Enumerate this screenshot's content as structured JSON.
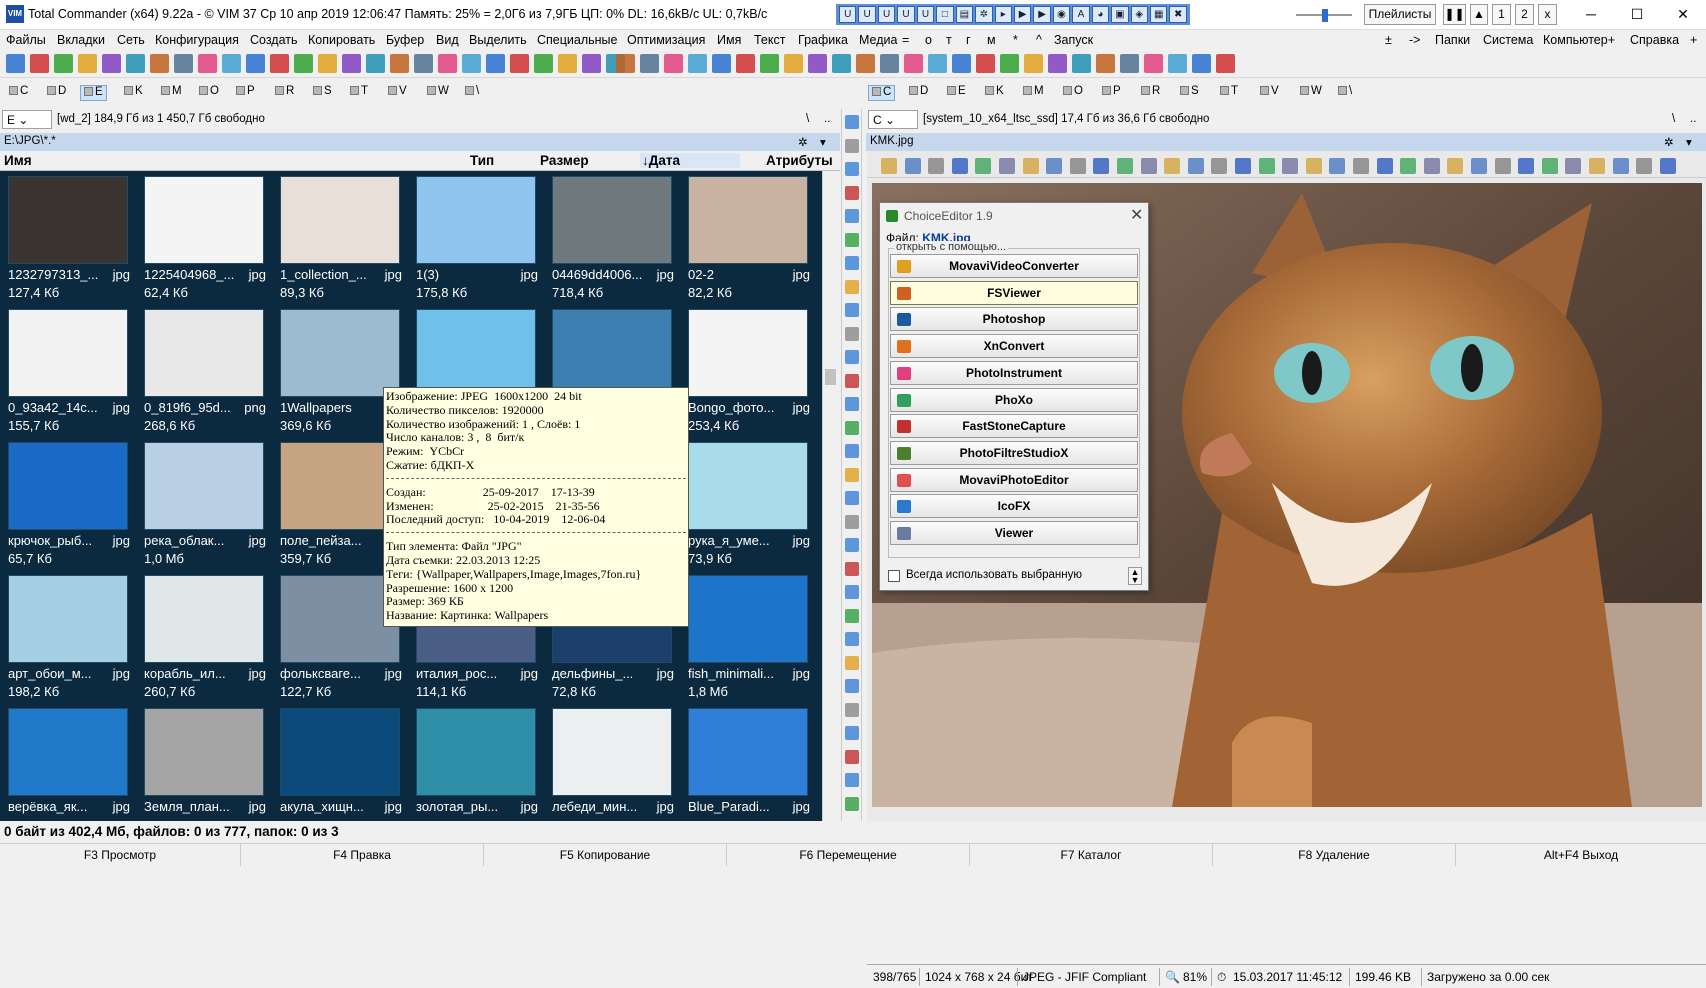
{
  "window": {
    "title": "Total Commander (x64) 9.22a - © VIM 37   Ср 10 апр 2019   12:06:47   Память: 25% = 2,0Г6 из 7,9ГБ   ЦП: 0%   DL: 16,6kB/c   UL: 0,7kB/c",
    "app_icon": "VIM",
    "playlists": "Плейлисты",
    "media_buttons": [
      "❚❚",
      "▲",
      "1",
      "2",
      "x"
    ]
  },
  "menu": [
    "Файлы",
    "Вкладки",
    "Сеть",
    "Конфигурация",
    "Создать",
    "Копировать",
    "Буфер",
    "Вид",
    "Выделить",
    "Специальные",
    "Оптимизация",
    "Имя",
    "Текст",
    "Графика",
    "Медиа",
    "=",
    "о",
    "т",
    "г",
    "м",
    "*",
    "^",
    "Запуск"
  ],
  "menu_right": [
    "±",
    "->",
    "Папки",
    "Система",
    "Компьютер+",
    "Справка",
    "+"
  ],
  "drives_left": [
    "C",
    "D",
    "E",
    "K",
    "M",
    "O",
    "P",
    "R",
    "S",
    "T",
    "V",
    "W",
    "\\"
  ],
  "drives_right": [
    "C",
    "D",
    "E",
    "K",
    "M",
    "O",
    "P",
    "R",
    "S",
    "T",
    "V",
    "W",
    "\\"
  ],
  "left": {
    "drive": "E",
    "drive_info": "[wd_2]  184,9 Гб из 1 450,7 Гб свободно",
    "path": "E:\\JPG\\*.*",
    "columns": [
      "Имя",
      "Тип",
      "Размер",
      "↓Дата",
      "Атрибуты"
    ],
    "files": [
      {
        "name": "1232797313_...",
        "ext": "jpg",
        "size": "127,4 Кб",
        "color": "#3a3430"
      },
      {
        "name": "1225404968_...",
        "ext": "jpg",
        "size": "62,4 Кб",
        "color": "#f4f4f4"
      },
      {
        "name": "1_collection_...",
        "ext": "jpg",
        "size": "89,3 Кб",
        "color": "#e8e0d8"
      },
      {
        "name": "1(3)",
        "ext": "jpg",
        "size": "175,8 Кб",
        "color": "#8ec4ee"
      },
      {
        "name": "04469dd4006...",
        "ext": "jpg",
        "size": "718,4 Кб",
        "color": "#6e7a7e"
      },
      {
        "name": "02-2",
        "ext": "jpg",
        "size": "82,2 Кб",
        "color": "#c8b4a0"
      },
      {
        "name": "0_93a42_14c...",
        "ext": "jpg",
        "size": "155,7 Кб",
        "color": "#f2f2f2"
      },
      {
        "name": "0_819f6_95d...",
        "ext": "png",
        "size": "268,6 Кб",
        "color": "#e8e8e8"
      },
      {
        "name": "1Wallpapers",
        "ext": "",
        "size": "369,6 Кб",
        "color": "#9cbbd0"
      },
      {
        "name": "",
        "ext": "",
        "size": "",
        "color": "#6fc0ea"
      },
      {
        "name": "",
        "ext": "",
        "size": "",
        "color": "#3d7fb0"
      },
      {
        "name": "Bongo_фото...",
        "ext": "jpg",
        "size": "253,4 Кб",
        "color": "#f4f4f4"
      },
      {
        "name": "крючок_рыб...",
        "ext": "jpg",
        "size": "65,7 Кб",
        "color": "#1a6ac8"
      },
      {
        "name": "река_облак...",
        "ext": "jpg",
        "size": "1,0 Мб",
        "color": "#b9cfe3"
      },
      {
        "name": "поле_пейза...",
        "ext": "jpg",
        "size": "359,7 Кб",
        "color": "#c7a582"
      },
      {
        "name": "",
        "ext": "",
        "size": "",
        "color": "#8fbfe0"
      },
      {
        "name": "",
        "ext": "",
        "size": "",
        "color": "#5f9fd0"
      },
      {
        "name": "рука_я_уме...",
        "ext": "jpg",
        "size": "73,9 Кб",
        "color": "#a8dce8"
      },
      {
        "name": "арт_обои_м...",
        "ext": "jpg",
        "size": "198,2 Кб",
        "color": "#a7cfe4"
      },
      {
        "name": "корабль_ил...",
        "ext": "jpg",
        "size": "260,7 Кб",
        "color": "#dfe7e8"
      },
      {
        "name": "фольксваге...",
        "ext": "jpg",
        "size": "122,7 Кб",
        "color": "#7d8fa2"
      },
      {
        "name": "италия_рос...",
        "ext": "jpg",
        "size": "114,1 Кб",
        "color": "#4b5e86"
      },
      {
        "name": "дельфины_...",
        "ext": "jpg",
        "size": "72,8 Кб",
        "color": "#1c3f6c"
      },
      {
        "name": "fish_minimali...",
        "ext": "jpg",
        "size": "1,8 Мб",
        "color": "#1e74c8"
      },
      {
        "name": "верёвка_як...",
        "ext": "jpg",
        "size": "",
        "color": "#1f78c8"
      },
      {
        "name": "Земля_план...",
        "ext": "jpg",
        "size": "",
        "color": "#a5a5a5"
      },
      {
        "name": "акула_хищн...",
        "ext": "jpg",
        "size": "",
        "color": "#0d4a7c"
      },
      {
        "name": "золотая_ры...",
        "ext": "jpg",
        "size": "",
        "color": "#2f8fa8"
      },
      {
        "name": "лебеди_мин...",
        "ext": "jpg",
        "size": "",
        "color": "#eceef0"
      },
      {
        "name": "Blue_Paradi...",
        "ext": "jpg",
        "size": "",
        "color": "#2f7fd8"
      }
    ],
    "status": "0 байт из 402,4 Мб, файлов: 0 из 777, папок: 0 из 3"
  },
  "tooltip": {
    "lines_a": [
      "Изображение: JPEG  1600x1200  24 bit",
      "Количество пикселов: 1920000",
      "Количество изображений: 1 , Слоёв: 1",
      "Число каналов: 3 ,  8  бит/к",
      "Режим:  YCbCr",
      "Сжатие: бДКП-X"
    ],
    "lines_b": [
      "Создан:                   25-09-2017    17-13-39",
      "Изменен:                  25-02-2015    21-35-56",
      "Последний доступ:   10-04-2019    12-06-04"
    ],
    "lines_c": [
      "Тип элемента: Файл \"JPG\"",
      "Дата съемки: 22.03.2013 12:25",
      "Теги: {Wallpaper,Wallpapers,Image,Images,7fon.ru}",
      "Разрешение: 1600 x 1200",
      "Размер: 369 КБ",
      "Название: Картинка: Wallpapers"
    ]
  },
  "right": {
    "drive": "C",
    "drive_info": "[system_10_x64_ltsc_ssd]  17,4 Гб из 36,6 Гб свободно",
    "path": "KMK.jpg",
    "status": [
      "398/765",
      "1024 x 768 x 24 бит",
      "JPEG - JFIF Compliant",
      "81%",
      "15.03.2017 11:45:12",
      "199.46 KB",
      "Загружено за 0.00 сек"
    ]
  },
  "chooser": {
    "title": "ChoiceEditor 1.9",
    "file_label": "Файл:",
    "file_name": "KMK.jpg",
    "group_label": "открыть с помощью...",
    "apps": [
      "MovaviVideoConverter",
      "FSViewer",
      "Photoshop",
      "XnConvert",
      "PhotoInstrument",
      "PhoXo",
      "FastStoneCapture",
      "PhotoFiltreStudioX",
      "MovaviPhotoEditor",
      "IcoFX",
      "Viewer"
    ],
    "selected": "FSViewer",
    "checkbox": "Всегда использовать выбранную"
  },
  "fkeys": [
    "F3 Просмотр",
    "F4 Правка",
    "F5 Копирование",
    "F6 Перемещение",
    "F7 Каталог",
    "F8 Удаление",
    "Alt+F4 Выход"
  ]
}
